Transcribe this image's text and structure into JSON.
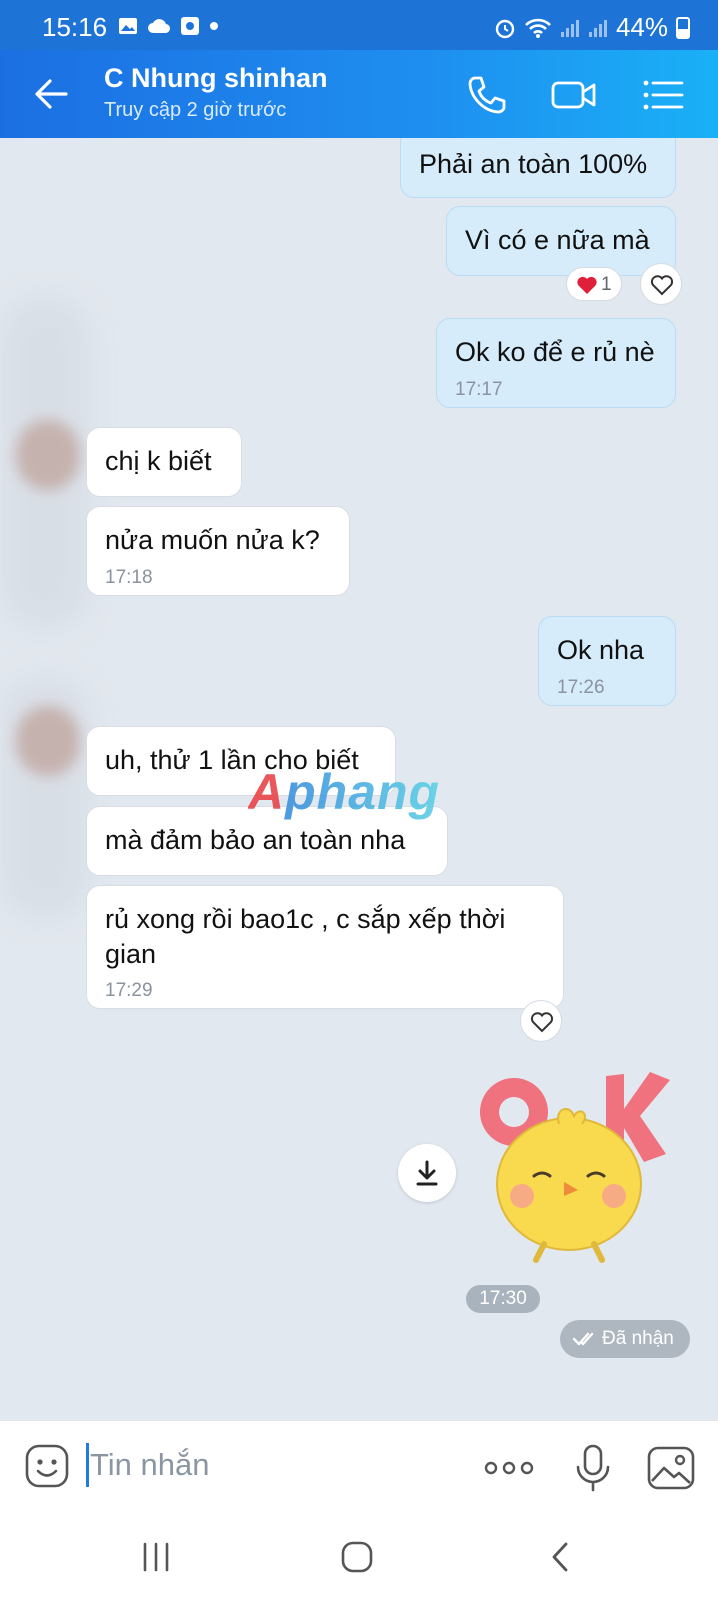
{
  "status_bar": {
    "time": "15:16",
    "battery": "44%"
  },
  "header": {
    "title": "C Nhung shinhan",
    "subtitle": "Truy cập 2 giờ trước"
  },
  "messages": [
    {
      "from": "me",
      "text": "Phải an toàn 100%"
    },
    {
      "from": "me",
      "text": "Vì có e nữa mà",
      "reaction": {
        "emoji": "❤️",
        "count": "1"
      }
    },
    {
      "from": "me",
      "text": "Ok ko để e rủ nè",
      "time": "17:17"
    },
    {
      "from": "them",
      "text": "chị k biết"
    },
    {
      "from": "them",
      "text": "nửa muốn nửa k?",
      "time": "17:18"
    },
    {
      "from": "me",
      "text": "Ok nha",
      "time": "17:26"
    },
    {
      "from": "them",
      "text": "uh, thử 1 lần cho biết"
    },
    {
      "from": "them",
      "text": "mà đảm bảo an toàn nha"
    },
    {
      "from": "them",
      "text": "rủ xong rồi bao1c , c sắp xếp thời gian",
      "time": "17:29"
    }
  ],
  "sticker": {
    "text": "OK",
    "time": "17:30"
  },
  "delivery_status": "Đã nhận",
  "watermark": "Aphang",
  "input": {
    "placeholder": "Tin nhắn"
  },
  "icons": {
    "header": [
      "back-arrow-icon",
      "phone-icon",
      "video-call-icon",
      "menu-list-icon"
    ],
    "input_bar": [
      "emoji-sticker-icon",
      "more-dots-icon",
      "microphone-icon",
      "image-gallery-icon"
    ],
    "nav": [
      "recents-icon",
      "home-icon",
      "back-icon"
    ]
  },
  "colors": {
    "header": "#1e8ff0",
    "my_bubble": "#d6ecfb",
    "their_bubble": "#ffffff",
    "chat_bg": "#e2e8ef",
    "heart": "#e0203a"
  }
}
